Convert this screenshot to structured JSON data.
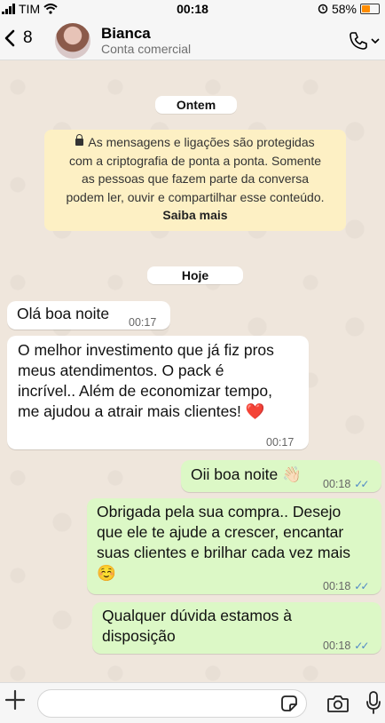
{
  "status": {
    "carrier": "TIM",
    "time": "00:18",
    "battery": "58%",
    "battery_level": 0.58
  },
  "header": {
    "back_count": "8",
    "name": "Bianca",
    "subtitle": "Conta comercial"
  },
  "chat": {
    "date_yesterday": "Ontem",
    "encryption_notice": {
      "lines": [
        "As mensagens e ligações são protegidas",
        "com a criptografia de ponta a ponta. Somente",
        "as pessoas que fazem parte da conversa",
        "podem ler, ouvir e compartilhar esse conteúdo."
      ],
      "learn_more": "Saiba mais"
    },
    "date_today": "Hoje",
    "messages": [
      {
        "direction": "in",
        "lines": [
          "Olá boa noite"
        ],
        "time": "00:17"
      },
      {
        "direction": "in",
        "lines": [
          "O melhor investimento que já fiz pros",
          "meus atendimentos. O pack é",
          "incrível.. Além de economizar tempo,",
          "me ajudou a atrair mais clientes!"
        ],
        "emoji": "❤️",
        "time": "00:17"
      },
      {
        "direction": "out",
        "lines": [
          "Oii boa noite"
        ],
        "emoji": "👋🏻",
        "time": "00:18"
      },
      {
        "direction": "out",
        "lines": [
          "Obrigada pela sua compra.. Desejo",
          "que ele te ajude a crescer, encantar",
          "suas clientes e brilhar cada vez mais"
        ],
        "emoji": "☺️",
        "time": "00:18"
      },
      {
        "direction": "out",
        "lines": [
          "Qualquer dúvida estamos à",
          "disposição"
        ],
        "time": "00:18"
      }
    ]
  },
  "colors": {
    "incoming": "#ffffff",
    "outgoing": "#dcf8c6",
    "read_ticks": "#4f88c6",
    "notice": "#fdf0c4"
  }
}
